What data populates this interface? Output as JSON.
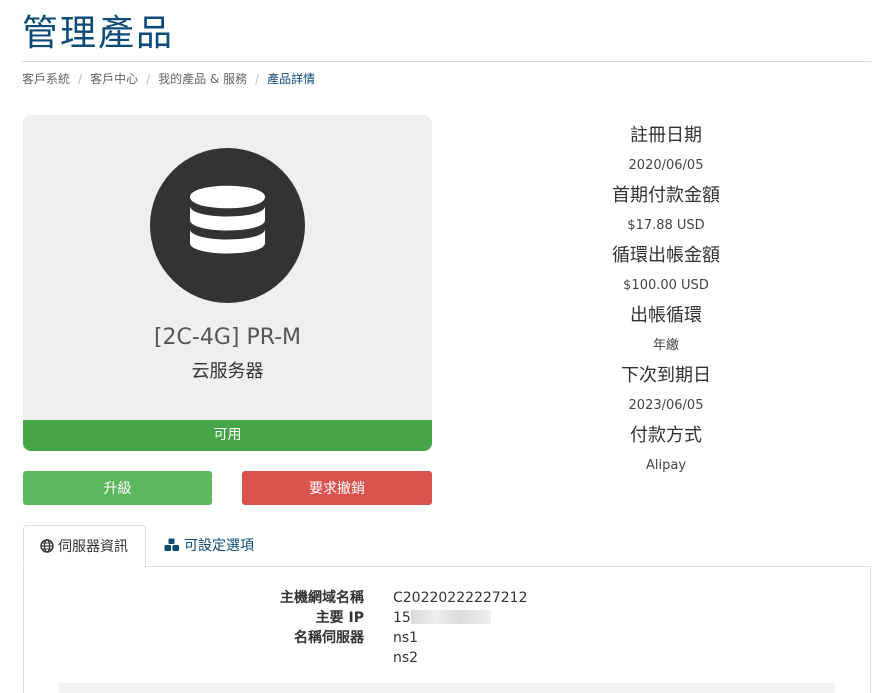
{
  "page": {
    "title": "管理產品"
  },
  "breadcrumb": [
    {
      "label": "客戶系統"
    },
    {
      "label": "客戶中心"
    },
    {
      "label": "我的產品 & 服務"
    },
    {
      "label": "產品詳情"
    }
  ],
  "product": {
    "icon": "database-icon",
    "name": "[2C-4G] PR-M",
    "group": "云服务器",
    "status": "可用"
  },
  "actions": {
    "upgrade_label": "升級",
    "cancel_label": "要求撤銷"
  },
  "billing_info": [
    {
      "label": "註冊日期",
      "value": "2020/06/05"
    },
    {
      "label": "首期付款金額",
      "value": "$17.88 USD"
    },
    {
      "label": "循環出帳金額",
      "value": "$100.00 USD"
    },
    {
      "label": "出帳循環",
      "value": "年繳"
    },
    {
      "label": "下次到期日",
      "value": "2023/06/05"
    },
    {
      "label": "付款方式",
      "value": "Alipay"
    }
  ],
  "tabs": [
    {
      "label": "伺服器資訊",
      "icon": "globe-icon",
      "active": true
    },
    {
      "label": "可設定選項",
      "icon": "cubes-icon",
      "active": false
    }
  ],
  "server_info": {
    "hostname_label": "主機網域名稱",
    "hostname_value": "C20220222227212",
    "ip_label": "主要 IP",
    "ip_value_visible": "15",
    "nameservers_label": "名稱伺服器",
    "ns1": "ns1",
    "ns2": "ns2"
  },
  "colors": {
    "title": "#0c4a78",
    "status_green": "#46a546",
    "upgrade_green": "#5cb85c",
    "cancel_red": "#d9534f",
    "card_bg": "#efefef"
  }
}
